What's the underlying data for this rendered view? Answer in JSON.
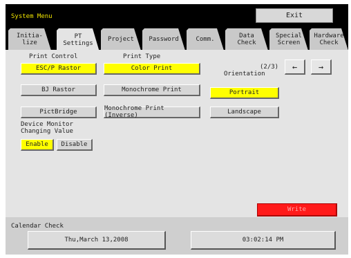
{
  "header": {
    "title": "System Menu",
    "exit_label": "Exit"
  },
  "tabs": [
    {
      "label": "Initia-\nlize"
    },
    {
      "label": "PT\nSettings"
    },
    {
      "label": "Project"
    },
    {
      "label": "Password"
    },
    {
      "label": "Comm."
    },
    {
      "label": "Data\nCheck"
    },
    {
      "label": "Special\nScreen"
    },
    {
      "label": "Hardware\nCheck"
    }
  ],
  "panel": {
    "print_control": {
      "heading": "Print Control",
      "options": [
        "ESC/P Rastor",
        "BJ Rastor",
        "PictBridge"
      ],
      "selected": "ESC/P Rastor"
    },
    "print_type": {
      "heading": "Print Type",
      "options": [
        "Color Print",
        "Monochrome Print",
        "Monochrome Print (Inverse)"
      ],
      "selected": "Color Print"
    },
    "orientation": {
      "heading": "Orientation",
      "options": [
        "Portrait",
        "Landscape"
      ],
      "selected": "Portrait"
    },
    "page_indicator": "(2/3)",
    "prev_arrow": "←",
    "next_arrow": "→",
    "device_monitor": {
      "heading_line1": "Device Monitor",
      "heading_line2": "Changing Value",
      "enable": "Enable",
      "disable": "Disable",
      "selected": "Enable"
    },
    "write_label": "Write"
  },
  "footer": {
    "label": "Calendar Check",
    "date": "Thu,March 13,2008",
    "time": "03:02:14 PM"
  },
  "colors": {
    "selected": "#ffff00",
    "write": "#ff1a1a",
    "title": "#f2e600"
  }
}
